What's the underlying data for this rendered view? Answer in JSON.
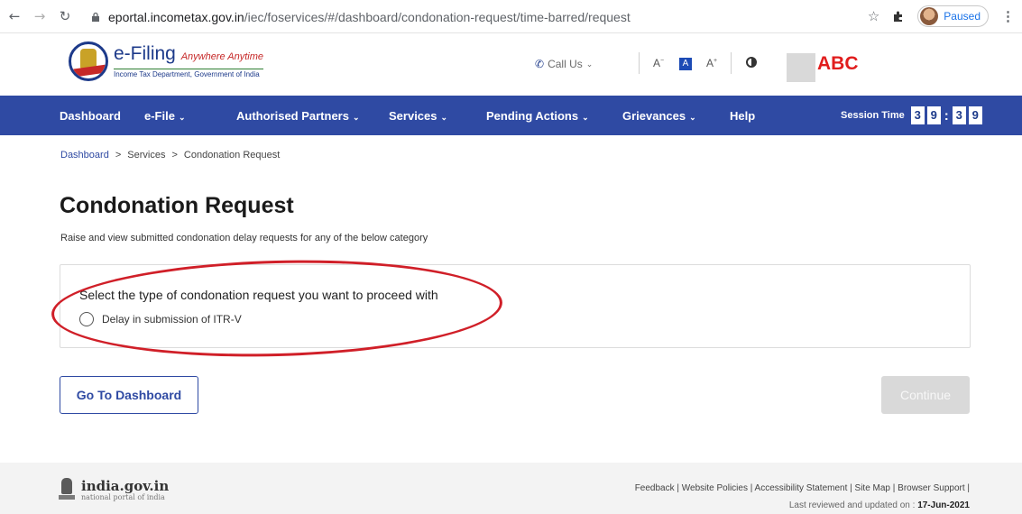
{
  "browser": {
    "url_host": "eportal.incometax.gov.in",
    "url_path": "/iec/foservices/#/dashboard/condonation-request/time-barred/request",
    "profile_status": "Paused"
  },
  "header": {
    "logo_main": "e-Filing",
    "logo_tagline": "Anywhere Anytime",
    "logo_sub": "Income Tax Department, Government of India",
    "call_us": "Call Us",
    "font_decrease": "A",
    "font_normal": "A",
    "font_increase": "A",
    "user_name": "ABC"
  },
  "nav": {
    "items": [
      {
        "label": "Dashboard",
        "chevron": false
      },
      {
        "label": "e-File",
        "chevron": true
      },
      {
        "label": "Authorised Partners",
        "chevron": true
      },
      {
        "label": "Services",
        "chevron": true
      },
      {
        "label": "Pending Actions",
        "chevron": true
      },
      {
        "label": "Grievances",
        "chevron": true
      },
      {
        "label": "Help",
        "chevron": false
      }
    ],
    "session_label": "Session Time",
    "session_digits": [
      "3",
      "9",
      "3",
      "9"
    ]
  },
  "breadcrumb": [
    "Dashboard",
    "Services",
    "Condonation Request"
  ],
  "page": {
    "title": "Condonation Request",
    "subtitle": "Raise and view submitted condonation delay requests for any of the below category"
  },
  "form": {
    "question": "Select the type of condonation request you want to proceed with",
    "options": [
      {
        "label": "Delay in submission of ITR-V",
        "selected": false
      }
    ]
  },
  "actions": {
    "back_label": "Go To Dashboard",
    "continue_label": "Continue"
  },
  "footer": {
    "portal_name": "india.gov.in",
    "portal_sub": "national portal of india",
    "links": "Feedback | Website Policies | Accessibility Statement | Site Map | Browser Support |",
    "updated_prefix": "Last reviewed and updated on :",
    "updated_date": "17-Jun-2021"
  },
  "colors": {
    "nav_bg": "#2f4aa3",
    "brand_blue": "#1d3a8a",
    "highlight_red": "#d01f28",
    "user_name_red": "#e11d1d"
  }
}
